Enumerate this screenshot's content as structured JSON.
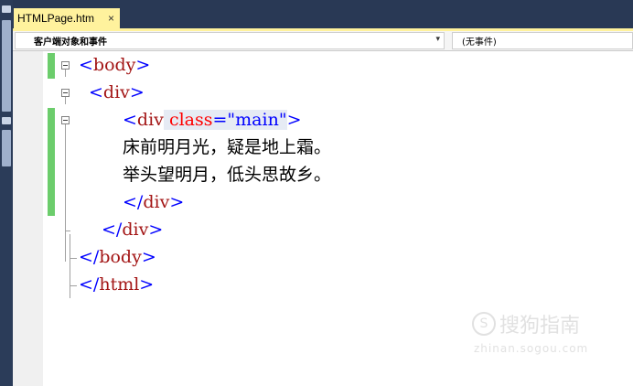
{
  "tab": {
    "title": "HTMLPage.htm",
    "close_glyph": "×"
  },
  "navbar": {
    "object_dropdown": "客户端对象和事件",
    "event_dropdown": "(无事件)",
    "arrow_glyph": "▾"
  },
  "code": {
    "line1": {
      "open": "<",
      "tag": "body",
      "close": ">"
    },
    "line2": {
      "open": "<",
      "tag": "div",
      "close": ">"
    },
    "line3": {
      "open": "<",
      "tag": "div",
      "attr": "class",
      "eq": "=",
      "val": "\"main\"",
      "close": ">"
    },
    "line4": "床前明月光，疑是地上霜。",
    "line5": "举头望明月，低头思故乡。",
    "line6": {
      "open": "</",
      "tag": "div",
      "close": ">"
    },
    "line7": {
      "open": "</",
      "tag": "div",
      "close": ">"
    },
    "line8": {
      "open": "</",
      "tag": "body",
      "close": ">"
    },
    "line9": {
      "open": "</",
      "tag": "html",
      "close": ">"
    }
  },
  "watermark": {
    "logo": "S",
    "text": "搜狗指南",
    "sub": "zhinan.sogou.com"
  },
  "colors": {
    "tab_active": "#fff29d",
    "tabbar_bg": "#293955",
    "change_marker": "#6ccd6c",
    "tag_color": "#a31515",
    "bracket_color": "#0000ff",
    "attr_color": "#ff0000"
  }
}
